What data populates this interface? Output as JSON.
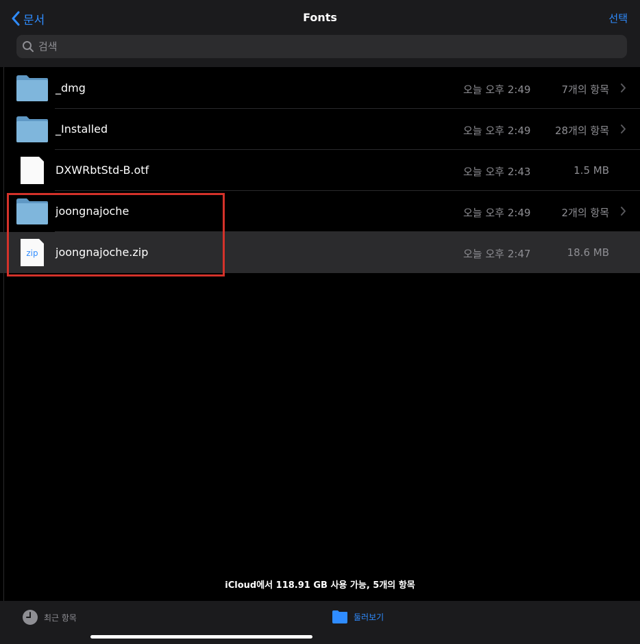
{
  "header": {
    "back_label": "문서",
    "title": "Fonts",
    "select_label": "선택"
  },
  "search": {
    "placeholder": "검색",
    "value": ""
  },
  "files": [
    {
      "name": "_dmg",
      "type": "folder",
      "date": "오늘 오후 2:49",
      "meta": "7개의 항목",
      "has_chevron": true,
      "selected": false
    },
    {
      "name": "_Installed",
      "type": "folder",
      "date": "오늘 오후 2:49",
      "meta": "28개의 항목",
      "has_chevron": true,
      "selected": false
    },
    {
      "name": "DXWRbtStd-B.otf",
      "type": "document",
      "date": "오늘 오후 2:43",
      "meta": "1.5 MB",
      "has_chevron": false,
      "selected": false
    },
    {
      "name": "joongnajoche",
      "type": "folder",
      "date": "오늘 오후 2:49",
      "meta": "2개의 항목",
      "has_chevron": true,
      "selected": false
    },
    {
      "name": "joongnajoche.zip",
      "type": "zip",
      "icon_label": "zip",
      "date": "오늘 오후 2:47",
      "meta": "18.6 MB",
      "has_chevron": false,
      "selected": true
    }
  ],
  "storage_text": "iCloud에서 118.91 GB 사용 가능, 5개의 항목",
  "tabbar": {
    "recents_label": "최근 항목",
    "browse_label": "둘러보기"
  },
  "colors": {
    "accent": "#2f8cff",
    "highlight_box": "#d4322a",
    "folder": "#7fb6dc"
  }
}
